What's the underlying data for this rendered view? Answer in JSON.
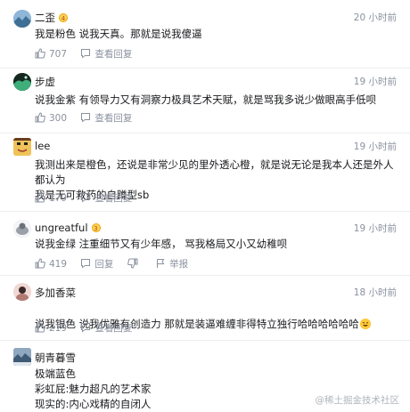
{
  "comments": [
    {
      "username": "二歪",
      "level": "4",
      "time": "20 小时前",
      "text": "我是粉色 说我天真。那就是说我傻逼",
      "likes": "707",
      "view_reply": "查看回复",
      "avatar_color": "#7aa3c9"
    },
    {
      "username": "步虚",
      "level": "",
      "time": "19 小时前",
      "text": "说我金紫 有领导力又有洞察力极具艺术天赋，就是骂我多说少做眼高手低呗",
      "likes": "300",
      "view_reply": "查看回复",
      "avatar_color": "#1b3a2c"
    },
    {
      "username": "lee",
      "level": "",
      "time": "19 小时前",
      "text": "我测出来是橙色，还说是非常少见的里外透心橙，就是说无论是我本人还是外人都认为\n我是无可救药的自蹲型sb",
      "likes": "179",
      "view_reply": "查看回复",
      "avatar_color": "#d9a441"
    },
    {
      "username": "ungreatful",
      "level": "3",
      "time": "19 小时前",
      "text": "说我金绿 注重细节又有少年感， 骂我格局又小又幼稚呗",
      "likes": "419",
      "reply": "回复",
      "report": "举报",
      "avatar_color": "#c9ccd1"
    },
    {
      "username": "多加香菜",
      "level": "",
      "time": "18 小时前",
      "text": "说我银色 说我优雅有创造力 那就是装逼难缠非得特立独行哈哈哈哈哈哈",
      "likes": "219",
      "view_reply": "查看回复",
      "avatar_color": "#e8c6c0"
    },
    {
      "username": "朝青暮雪",
      "level": "",
      "time": "18 小时前",
      "text": "极端蓝色\n彩虹屁:魅力超凡的艺术家\n现实的:内心戏精的自闭人",
      "avatar_color": "#5d7e9e"
    }
  ],
  "watermark": "@稀土掘金技术社区",
  "colors": {
    "meta_gray": "#8a919f",
    "text": "#18191c",
    "separator": "#eceef0",
    "level_badge": "#ffd15c"
  },
  "icons": {
    "like": "thumbs-up-icon",
    "comment": "comment-bubble-icon",
    "dislike": "thumbs-down-icon",
    "report": "flag-icon",
    "emoji": "rofl-emoji-icon"
  }
}
